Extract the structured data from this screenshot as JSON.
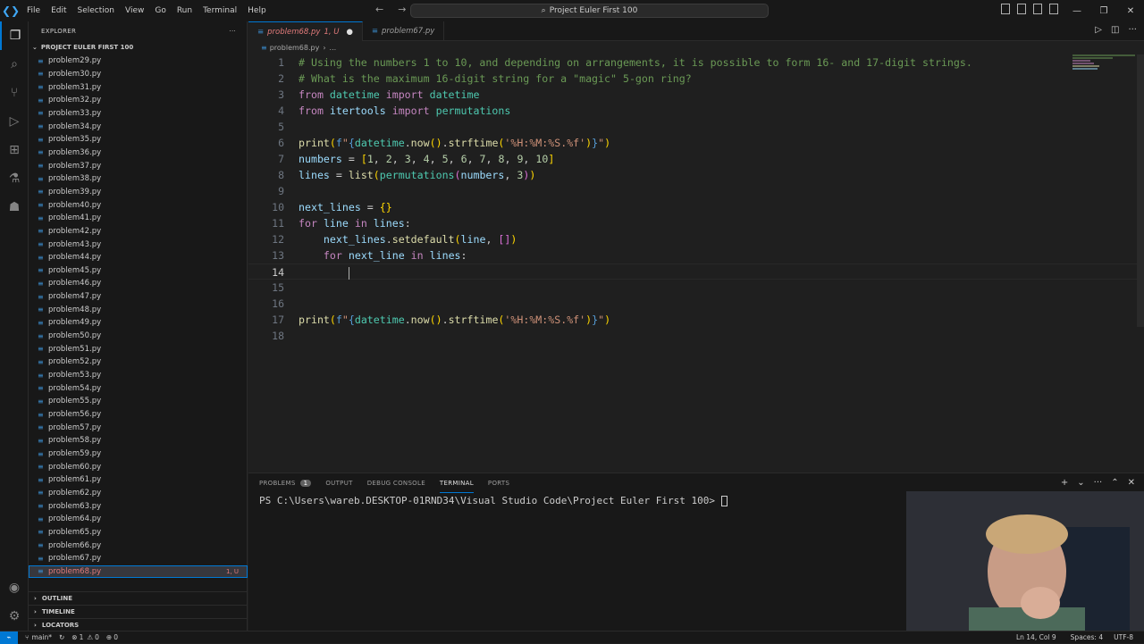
{
  "titlebar": {
    "menu": [
      "File",
      "Edit",
      "Selection",
      "View",
      "Go",
      "Run",
      "Terminal",
      "Help"
    ],
    "search": "Project Euler First 100"
  },
  "explorer": {
    "header": "EXPLORER",
    "project": "PROJECT EULER FIRST 100",
    "files": [
      "problem29.py",
      "problem30.py",
      "problem31.py",
      "problem32.py",
      "problem33.py",
      "problem34.py",
      "problem35.py",
      "problem36.py",
      "problem37.py",
      "problem38.py",
      "problem39.py",
      "problem40.py",
      "problem41.py",
      "problem42.py",
      "problem43.py",
      "problem44.py",
      "problem45.py",
      "problem46.py",
      "problem47.py",
      "problem48.py",
      "problem49.py",
      "problem50.py",
      "problem51.py",
      "problem52.py",
      "problem53.py",
      "problem54.py",
      "problem55.py",
      "problem56.py",
      "problem57.py",
      "problem58.py",
      "problem59.py",
      "problem60.py",
      "problem61.py",
      "problem62.py",
      "problem63.py",
      "problem64.py",
      "problem65.py",
      "problem66.py",
      "problem67.py",
      "problem68.py"
    ],
    "active_file": "problem68.py",
    "active_badge": "1, U",
    "sections": [
      "OUTLINE",
      "TIMELINE",
      "LOCATORS"
    ]
  },
  "tabs": [
    {
      "label": "problem68.py",
      "status": "1, U"
    },
    {
      "label": "problem67.py"
    }
  ],
  "breadcrumb": [
    "problem68.py",
    "..."
  ],
  "code": {
    "lines": [
      "# Using the numbers 1 to 10, and depending on arrangements, it is possible to form 16- and 17-digit strings.",
      "# What is the maximum 16-digit string for a \"magic\" 5-gon ring?",
      "from datetime import datetime",
      "from itertools import permutations",
      "",
      "print(f\"{datetime.now().strftime('%H:%M:%S.%f')}\")",
      "numbers = [1, 2, 3, 4, 5, 6, 7, 8, 9, 10]",
      "lines = list(permutations(numbers, 3))",
      "",
      "next_lines = {}",
      "for line in lines:",
      "    next_lines.setdefault(line, [])",
      "    for next_line in lines:",
      "",
      "",
      "",
      "print(f\"{datetime.now().strftime('%H:%M:%S.%f')}\")",
      ""
    ],
    "current_line": 14
  },
  "panel": {
    "tabs": [
      "PROBLEMS",
      "OUTPUT",
      "DEBUG CONSOLE",
      "TERMINAL",
      "PORTS"
    ],
    "problems_count": "1",
    "active_tab": "TERMINAL",
    "terminal_prompt": "PS C:\\Users\\wareb.DESKTOP-01RND34\\Visual Studio Code\\Project Euler First 100> "
  },
  "status": {
    "branch": "main*",
    "errors": "1",
    "warnings": "0",
    "ports": "0",
    "position": "Ln 14, Col 9",
    "spaces": "Spaces: 4",
    "encoding": "UTF-8"
  },
  "colors": {
    "accent": "#0078d4",
    "modified_file": "#e07a7a",
    "comment": "#6a9955",
    "keyword": "#c586c0"
  }
}
